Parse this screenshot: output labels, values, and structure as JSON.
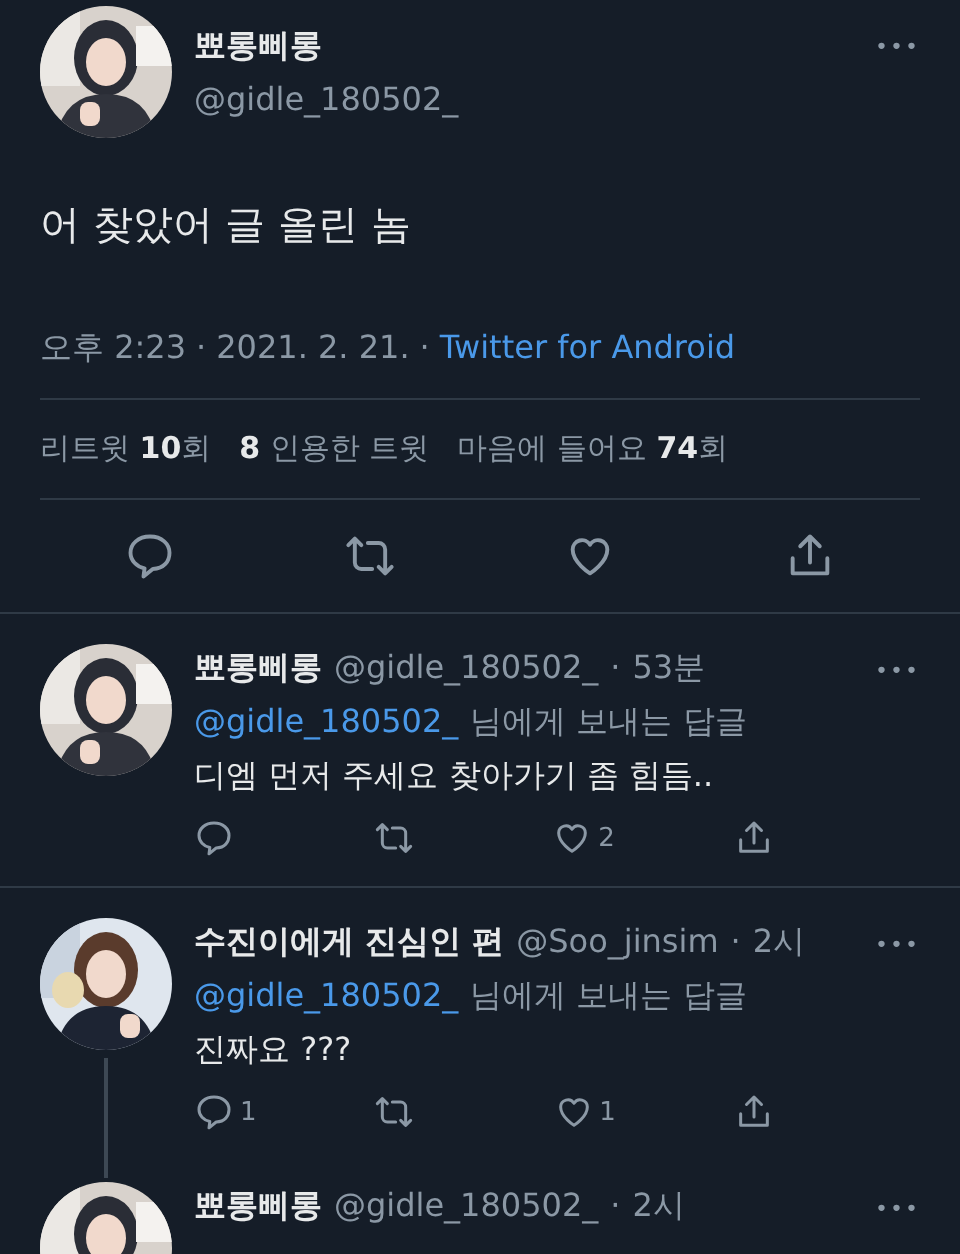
{
  "tweet": {
    "name": "뾰롱삐롱",
    "handle": "@gidle_180502_",
    "more": "•••",
    "text": "어 찾았어 글 올린 놈",
    "time": "오후 2:23",
    "sep_1": "·",
    "sep_2": "·",
    "date": "2021. 2. 21.",
    "source": "Twitter for Android",
    "stats": [
      "리트윗 **10**회",
      "**8** 인용한 트윗",
      "마음에 들어요 **74**회"
    ]
  },
  "replies": [
    {
      "name": "뾰롱삐롱",
      "handle": "@gidle_180502_",
      "sep": "·",
      "time": "53분",
      "more": "•••",
      "reply_to": "@gidle_180502_",
      "reply_suffix": "님에게 보내는 답글",
      "text": "디엠 먼저 주세요 찾아가기 좀 힘듬..",
      "like_count": "2",
      "thread_below": false
    },
    {
      "name": "수진이에게 진심인 편",
      "handle": "@Soo_jinsim",
      "sep": "·",
      "time": "2시",
      "more": "•••",
      "reply_to": "@gidle_180502_",
      "reply_suffix": "님에게 보내는 답글",
      "text": "진짜요 ???",
      "reply_count": "1",
      "like_count": "1",
      "thread_below": true
    },
    {
      "name": "뾰롱삐롱",
      "handle": "@gidle_180502_",
      "sep": "·",
      "time": "2시",
      "more": "•••",
      "thread_below": false
    }
  ]
}
